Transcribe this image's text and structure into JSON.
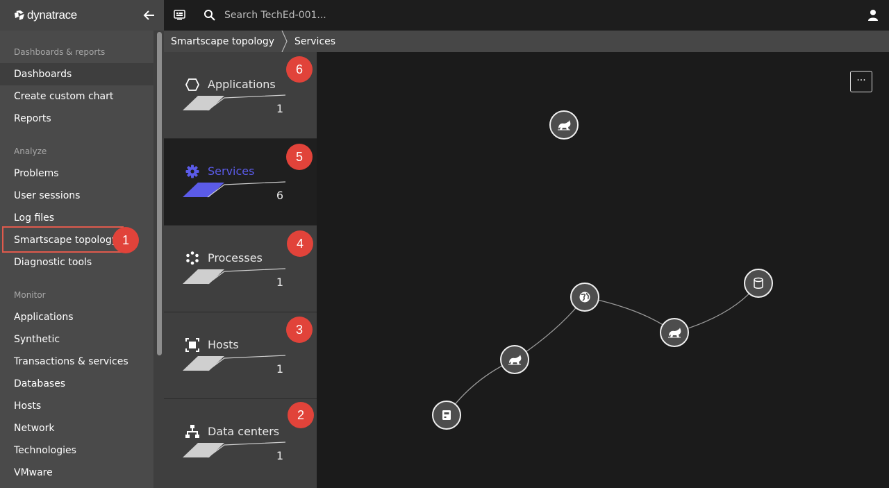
{
  "app": {
    "logo_text": "dynatrace"
  },
  "topbar": {
    "search_placeholder": "Search TechEd-001..."
  },
  "breadcrumb": {
    "items": [
      "Smartscape topology",
      "Services"
    ]
  },
  "sidebar": {
    "sections": [
      {
        "title": "Dashboards & reports",
        "items": [
          "Dashboards",
          "Create custom chart",
          "Reports"
        ]
      },
      {
        "title": "Analyze",
        "items": [
          "Problems",
          "User sessions",
          "Log files",
          "Smartscape topology",
          "Diagnostic tools"
        ]
      },
      {
        "title": "Monitor",
        "items": [
          "Applications",
          "Synthetic",
          "Transactions & services",
          "Databases",
          "Hosts",
          "Network",
          "Technologies",
          "VMware"
        ]
      }
    ],
    "active_item": "Dashboards",
    "highlighted_item": "Smartscape topology"
  },
  "layers": [
    {
      "name": "Applications",
      "count": "1",
      "icon": "hexagon-icon",
      "selected": false
    },
    {
      "name": "Services",
      "count": "6",
      "icon": "gear-icon",
      "selected": true
    },
    {
      "name": "Processes",
      "count": "1",
      "icon": "process-icon",
      "selected": false
    },
    {
      "name": "Hosts",
      "count": "1",
      "icon": "host-icon",
      "selected": false
    },
    {
      "name": "Data centers",
      "count": "1",
      "icon": "datacenter-icon",
      "selected": false
    }
  ],
  "callouts": [
    "1",
    "2",
    "3",
    "4",
    "5",
    "6"
  ],
  "canvas": {
    "more_label": "···",
    "nodes": [
      {
        "icon": "tomcat-icon"
      },
      {
        "icon": "globe-icon"
      },
      {
        "icon": "database-icon"
      },
      {
        "icon": "tomcat-icon"
      },
      {
        "icon": "tomcat-icon"
      },
      {
        "icon": "terminal-icon"
      }
    ]
  },
  "colors": {
    "sidebar_bg": "#4a4a4a",
    "accent_selected": "#5b5be8",
    "callout_red": "#e1433a",
    "canvas_bg": "#1b1b1b"
  }
}
